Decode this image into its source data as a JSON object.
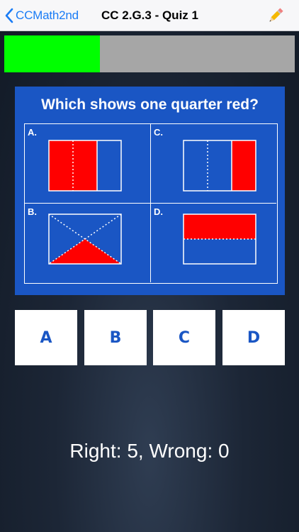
{
  "navbar": {
    "back_label": "CCMath2nd",
    "title": "CC 2.G.3 - Quiz 1",
    "edit_icon": "pencil-icon"
  },
  "progress": {
    "fraction": 0.33,
    "fill_color": "#00ff00",
    "track_color": "#a6a6a6"
  },
  "question": {
    "text": "Which shows one quarter red?",
    "options": [
      {
        "label": "A."
      },
      {
        "label": "B."
      },
      {
        "label": "C."
      },
      {
        "label": "D."
      }
    ]
  },
  "answers": [
    "A",
    "B",
    "C",
    "D"
  ],
  "score": {
    "text": "Right: 5, Wrong: 0"
  },
  "colors": {
    "accent_blue": "#1a56c4",
    "shape_red": "#ff0000",
    "ios_blue": "#1a7cf5"
  }
}
